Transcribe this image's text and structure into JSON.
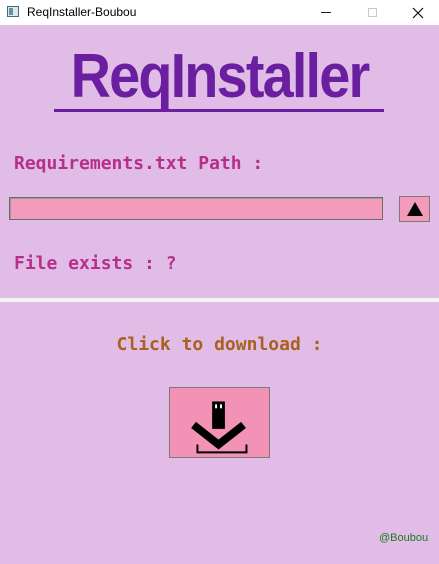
{
  "window": {
    "title": "ReqInstaller-Boubou",
    "icons": [
      "app-icon",
      "minimize-icon",
      "maximize-icon",
      "close-icon"
    ]
  },
  "header": {
    "title": "ReqInstaller"
  },
  "path_section": {
    "label": "Requirements.txt Path :",
    "input_value": "",
    "browse_icon": "up-triangle-icon"
  },
  "status": {
    "file_exists": "File exists : ?"
  },
  "download": {
    "label": "Click to download :",
    "icon": "download-arrow-icon"
  },
  "footer": {
    "credit": "@Boubou"
  },
  "colors": {
    "background": "#e0bce6",
    "title": "#6a1fa0",
    "labels": "#b62f8a",
    "download_label": "#a8611f",
    "button_fill": "#f29bbb",
    "credit": "#1f7a1f"
  }
}
